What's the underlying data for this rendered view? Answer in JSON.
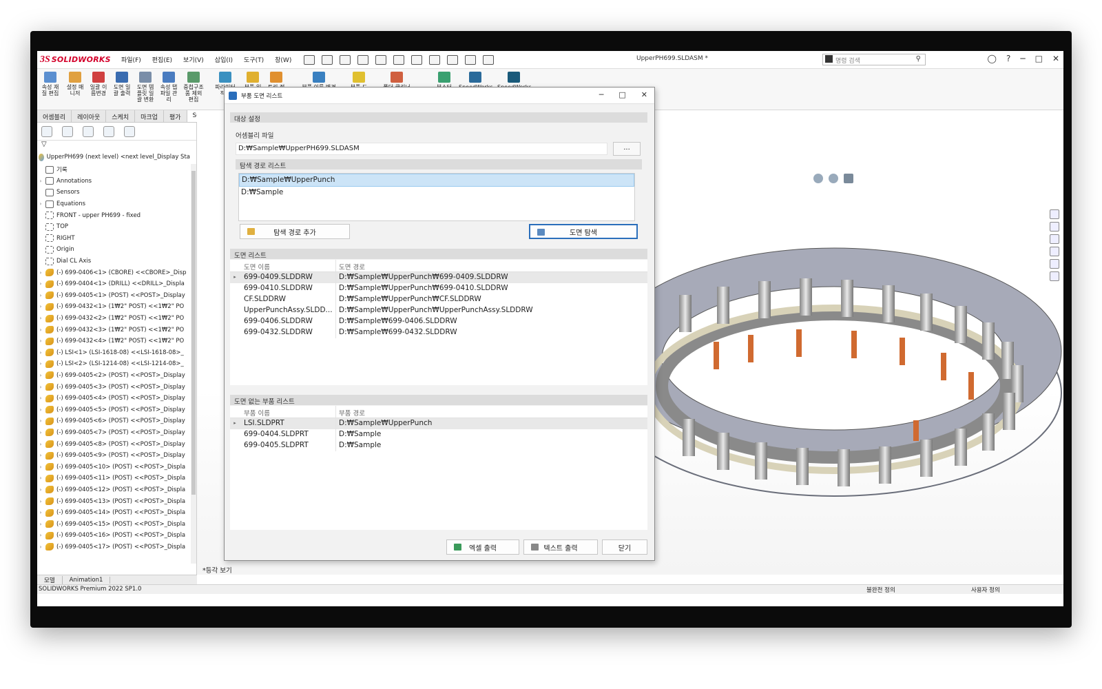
{
  "app": {
    "logo_ds": "3S",
    "logo_name": "SOLIDWORKS",
    "menus": [
      "파일(F)",
      "편집(E)",
      "보기(V)",
      "삽입(I)",
      "도구(T)",
      "창(W)"
    ],
    "document_title": "UpperPH699.SLDASM *",
    "search_placeholder": "명령 검색",
    "window_buttons": [
      "─",
      "□",
      "✕"
    ]
  },
  "ribbon": {
    "buttons": [
      "속성 재 질 편집",
      "설정 매 니저",
      "일괄 이 름변경",
      "도면 일 괄 출력",
      "도면 템 플릿 일 괄 변환",
      "속성 탭 파일 관 리",
      "중첩구조 품 제외 편집",
      "파라미터 적용",
      "부품 일 괄 열기",
      "트리 정 리",
      "부품 이름 변경",
      "부품 도 면 리스트",
      "폴더 클리너",
      "부스터",
      "SpeedWorks",
      "SpeedWorks"
    ]
  },
  "command_tabs": [
    "어셈블리",
    "레이아웃",
    "스케치",
    "마크업",
    "평가",
    "SOLIDWO"
  ],
  "feature_tree": {
    "root": "UpperPH699 (next level) <next level_Display Sta",
    "items": [
      {
        "label": "기록",
        "icon": "folder",
        "exp": ""
      },
      {
        "label": "Annotations",
        "icon": "folder",
        "exp": "›"
      },
      {
        "label": "Sensors",
        "icon": "folder",
        "exp": ""
      },
      {
        "label": "Equations",
        "icon": "folder",
        "exp": "›"
      },
      {
        "label": "FRONT - upper PH699 - fixed",
        "icon": "plane",
        "exp": ""
      },
      {
        "label": "TOP",
        "icon": "plane",
        "exp": ""
      },
      {
        "label": "RIGHT",
        "icon": "plane",
        "exp": ""
      },
      {
        "label": "Origin",
        "icon": "plane",
        "exp": ""
      },
      {
        "label": "Dial CL Axis",
        "icon": "plane",
        "exp": ""
      },
      {
        "label": "(-) 699-0406<1> (CBORE) <<CBORE>_Disp",
        "icon": "part",
        "exp": "›"
      },
      {
        "label": "(-) 699-0404<1> (DRILL) <<DRILL>_Displa",
        "icon": "part",
        "exp": "›"
      },
      {
        "label": "(-) 699-0405<1> (POST) <<POST>_Display",
        "icon": "part",
        "exp": "›"
      },
      {
        "label": "(-) 699-0432<1> (1₩2\" POST) <<1₩2\" PO",
        "icon": "part",
        "exp": "›"
      },
      {
        "label": "(-) 699-0432<2> (1₩2\" POST) <<1₩2\" PO",
        "icon": "part",
        "exp": "›"
      },
      {
        "label": "(-) 699-0432<3> (1₩2\" POST) <<1₩2\" PO",
        "icon": "part",
        "exp": "›"
      },
      {
        "label": "(-) 699-0432<4> (1₩2\" POST) <<1₩2\" PO",
        "icon": "part",
        "exp": "›"
      },
      {
        "label": "(-) LSI<1> (LSI-1618-08) <<LSI-1618-08>_",
        "icon": "part",
        "exp": "›"
      },
      {
        "label": "(-) LSI<2> (LSI-1214-08) <<LSI-1214-08>_",
        "icon": "part",
        "exp": "›"
      },
      {
        "label": "(-) 699-0405<2> (POST) <<POST>_Display",
        "icon": "part",
        "exp": "›"
      },
      {
        "label": "(-) 699-0405<3> (POST) <<POST>_Display",
        "icon": "part",
        "exp": "›"
      },
      {
        "label": "(-) 699-0405<4> (POST) <<POST>_Display",
        "icon": "part",
        "exp": "›"
      },
      {
        "label": "(-) 699-0405<5> (POST) <<POST>_Display",
        "icon": "part",
        "exp": "›"
      },
      {
        "label": "(-) 699-0405<6> (POST) <<POST>_Display",
        "icon": "part",
        "exp": "›"
      },
      {
        "label": "(-) 699-0405<7> (POST) <<POST>_Display",
        "icon": "part",
        "exp": "›"
      },
      {
        "label": "(-) 699-0405<8> (POST) <<POST>_Display",
        "icon": "part",
        "exp": "›"
      },
      {
        "label": "(-) 699-0405<9> (POST) <<POST>_Display",
        "icon": "part",
        "exp": "›"
      },
      {
        "label": "(-) 699-0405<10> (POST) <<POST>_Displa",
        "icon": "part",
        "exp": "›"
      },
      {
        "label": "(-) 699-0405<11> (POST) <<POST>_Displa",
        "icon": "part",
        "exp": "›"
      },
      {
        "label": "(-) 699-0405<12> (POST) <<POST>_Displa",
        "icon": "part",
        "exp": "›"
      },
      {
        "label": "(-) 699-0405<13> (POST) <<POST>_Displa",
        "icon": "part",
        "exp": "›"
      },
      {
        "label": "(-) 699-0405<14> (POST) <<POST>_Displa",
        "icon": "part",
        "exp": "›"
      },
      {
        "label": "(-) 699-0405<15> (POST) <<POST>_Displa",
        "icon": "part",
        "exp": "›"
      },
      {
        "label": "(-) 699-0405<16> (POST) <<POST>_Displa",
        "icon": "part",
        "exp": "›"
      },
      {
        "label": "(-) 699-0405<17> (POST) <<POST>_Displa",
        "icon": "part",
        "exp": "›"
      }
    ]
  },
  "bottom_tabs": [
    "모델",
    "Animation1"
  ],
  "view_label": "*등각 보기",
  "status": {
    "left": "SOLIDWORKS Premium 2022 SP1.0",
    "middle": "불완전 정의",
    "right": "사용자 정의"
  },
  "dialog": {
    "title": "부품 도면 리스트",
    "title_buttons": [
      "─",
      "□",
      "✕"
    ],
    "target_section": "대상 설정",
    "assembly_file_label": "어셈블리 파일",
    "assembly_path": "D:₩Sample₩UpperPH699.SLDASM",
    "browse_label": "...",
    "search_path_section": "탐색 경로 리스트",
    "search_paths": [
      "D:₩Sample₩UpperPunch",
      "D:₩Sample"
    ],
    "add_path_button": "탐색 경로 추가",
    "search_drawing_button": "도면 탐색",
    "drawing_list_section": "도면 리스트",
    "drawing_columns": [
      "도면 이름",
      "도면 경로"
    ],
    "drawings": [
      {
        "name": "699-0409.SLDDRW",
        "path": "D:₩Sample₩UpperPunch₩699-0409.SLDDRW"
      },
      {
        "name": "699-0410.SLDDRW",
        "path": "D:₩Sample₩UpperPunch₩699-0410.SLDDRW"
      },
      {
        "name": "CF.SLDDRW",
        "path": "D:₩Sample₩UpperPunch₩CF.SLDDRW"
      },
      {
        "name": "UpperPunchAssy.SLDD...",
        "path": "D:₩Sample₩UpperPunch₩UpperPunchAssy.SLDDRW"
      },
      {
        "name": "699-0406.SLDDRW",
        "path": "D:₩Sample₩699-0406.SLDDRW"
      },
      {
        "name": "699-0432.SLDDRW",
        "path": "D:₩Sample₩699-0432.SLDDRW"
      }
    ],
    "no_drawing_section": "도면 없는 부품 리스트",
    "part_columns": [
      "부품 이름",
      "부품 경로"
    ],
    "parts": [
      {
        "name": "LSI.SLDPRT",
        "path": "D:₩Sample₩UpperPunch"
      },
      {
        "name": "699-0404.SLDPRT",
        "path": "D:₩Sample"
      },
      {
        "name": "699-0405.SLDPRT",
        "path": "D:₩Sample"
      }
    ],
    "excel_button": "엑셀 출력",
    "text_button": "텍스트 출력",
    "close_button": "닫기"
  },
  "colors": {
    "accent": "#2a6ebb",
    "selection": "#cce4f7",
    "brand": "#d4002a"
  }
}
